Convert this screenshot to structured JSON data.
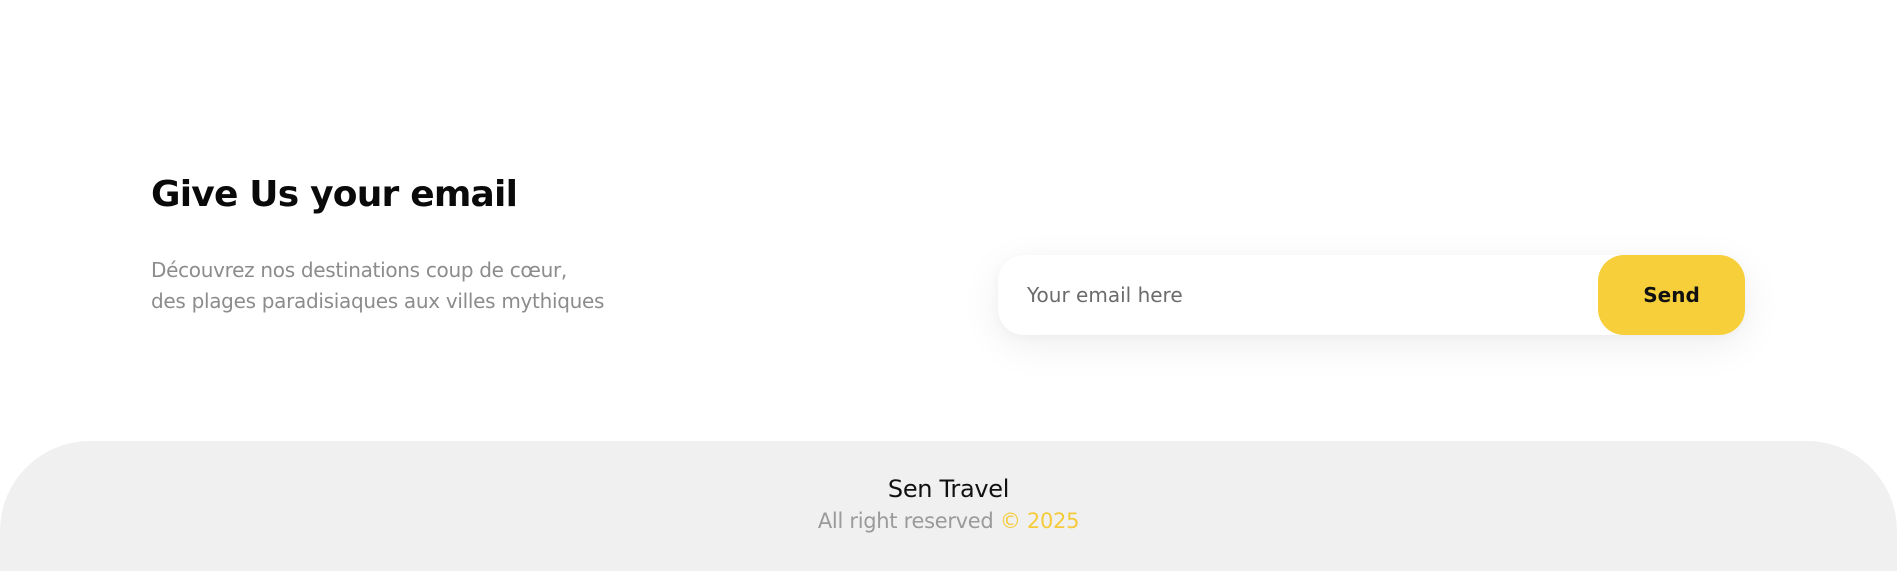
{
  "newsletter": {
    "title": "Give Us your email",
    "description_lines": [
      "Découvrez nos destinations coup de cœur,",
      "des plages paradisiaques aux villes mythiques"
    ],
    "email_input": {
      "placeholder": "Your email here",
      "value": ""
    },
    "send_label": "Send"
  },
  "footer": {
    "brand": "Sen Travel",
    "rights_text": "All right reserved",
    "copyright": "© 2025"
  },
  "colors": {
    "accent": "#f7cf3a",
    "footer_background": "#f0f0f0",
    "muted_text": "#8c8c8c",
    "heading_text": "#0a0a0a"
  }
}
